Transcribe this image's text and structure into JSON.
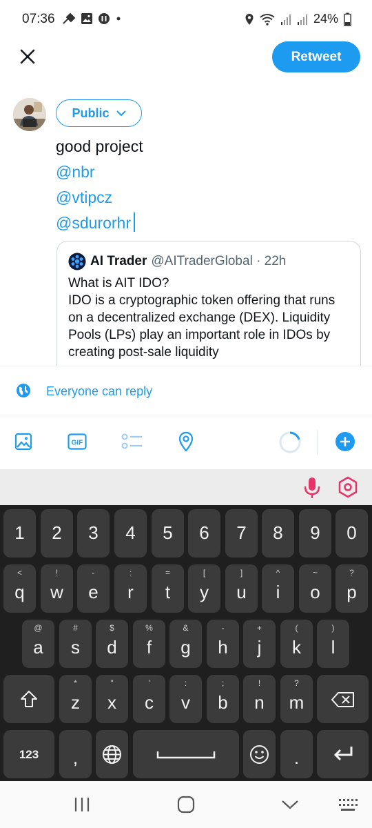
{
  "status_bar": {
    "time": "07:36",
    "battery": "24%"
  },
  "header": {
    "retweet_label": "Retweet"
  },
  "compose": {
    "audience_label": "Public",
    "line1": "good project",
    "mentions": [
      "@nbr",
      "@vtipcz",
      "@sdurorhr"
    ]
  },
  "quote": {
    "name": "AI Trader",
    "handle": "@AITraderGlobal · 22h",
    "title": "What is AIT IDO?",
    "body": "IDO is a cryptographic token offering that runs on a decentralized exchange (DEX). Liquidity Pools (LPs) play an important role in IDOs by creating post-sale liquidity"
  },
  "reply_setting": "Everyone can reply",
  "keyboard": {
    "number_row": [
      "1",
      "2",
      "3",
      "4",
      "5",
      "6",
      "7",
      "8",
      "9",
      "0"
    ],
    "row1": [
      [
        "q",
        "<"
      ],
      [
        "w",
        "!"
      ],
      [
        "e",
        "-"
      ],
      [
        "r",
        ":"
      ],
      [
        "t",
        "="
      ],
      [
        "y",
        "["
      ],
      [
        "u",
        "]"
      ],
      [
        "i",
        "^"
      ],
      [
        "o",
        "~"
      ],
      [
        "p",
        "?"
      ]
    ],
    "row2": [
      [
        "a",
        "@"
      ],
      [
        "s",
        "#"
      ],
      [
        "d",
        "$"
      ],
      [
        "f",
        "%"
      ],
      [
        "g",
        "&"
      ],
      [
        "h",
        "-"
      ],
      [
        "j",
        "+"
      ],
      [
        "k",
        "("
      ],
      [
        "l",
        ")"
      ]
    ],
    "row3": [
      [
        "z",
        "*"
      ],
      [
        "x",
        "\""
      ],
      [
        "c",
        "'"
      ],
      [
        "v",
        ":"
      ],
      [
        "b",
        ";"
      ],
      [
        "n",
        "!"
      ],
      [
        "m",
        "?"
      ]
    ],
    "symbols_label": "123",
    "comma": ",",
    "period": "."
  },
  "colors": {
    "accent": "#1d9bf0",
    "keyboard_bg": "#1f1f1f",
    "key_bg": "#3b3b3b"
  }
}
